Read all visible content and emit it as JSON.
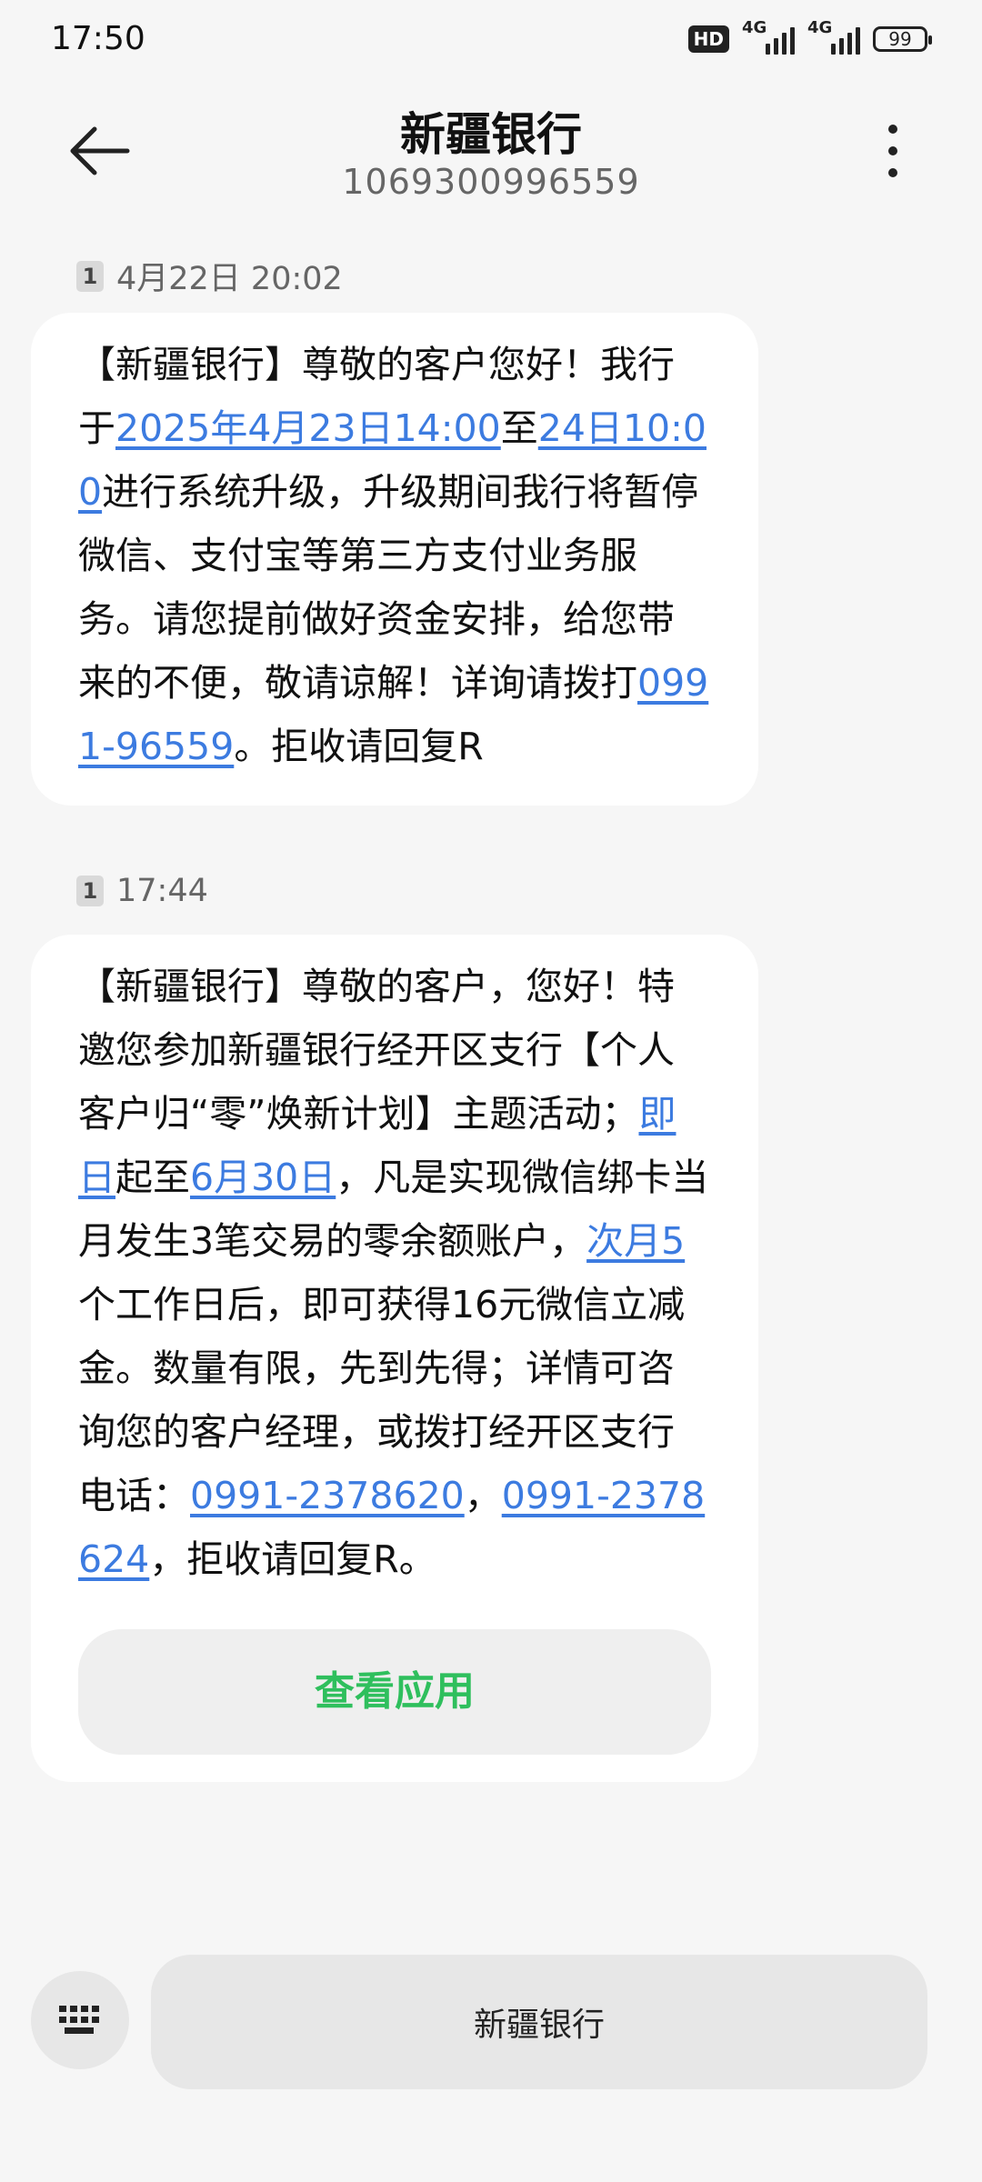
{
  "status_bar": {
    "time": "17:50",
    "hd_badge": "HD",
    "network_1": "4G",
    "network_2": "4G",
    "battery": "99"
  },
  "header": {
    "title": "新疆银行",
    "number": "1069300996559",
    "back_icon": "arrow-left-icon",
    "menu_icon": "more-vertical-icon"
  },
  "messages": [
    {
      "sim": "1",
      "timestamp": "4月22日 20:02",
      "segments": [
        {
          "text": "【新疆银行】尊敬的客户您好！我行于",
          "link": false
        },
        {
          "text": "2025年4月23日14:00",
          "link": true
        },
        {
          "text": "至",
          "link": false
        },
        {
          "text": "24日10:00",
          "link": true
        },
        {
          "text": "进行系统升级，升级期间我行将暂停微信、支付宝等第三方支付业务服务。请您提前做好资金安排，给您带来的不便，敬请谅解！详询请拨打",
          "link": false
        },
        {
          "text": "0991-96559",
          "link": true
        },
        {
          "text": "。拒收请回复R",
          "link": false
        }
      ]
    },
    {
      "sim": "1",
      "timestamp": "17:44",
      "segments": [
        {
          "text": "【新疆银行】尊敬的客户，您好！特邀您参加新疆银行经开区支行【个人客户归“零”焕新计划】主题活动；",
          "link": false
        },
        {
          "text": "即日",
          "link": true
        },
        {
          "text": "起至",
          "link": false
        },
        {
          "text": "6月30日",
          "link": true
        },
        {
          "text": "，凡是实现微信绑卡当月发生3笔交易的零余额账户，",
          "link": false
        },
        {
          "text": "次月5",
          "link": true
        },
        {
          "text": "个工作日后，即可获得16元微信立减金。数量有限，先到先得；详情可咨询您的客户经理，或拨打经开区支行电话：",
          "link": false
        },
        {
          "text": "0991-2378620",
          "link": true
        },
        {
          "text": "，",
          "link": false
        },
        {
          "text": "0991-2378624",
          "link": true
        },
        {
          "text": "，拒收请回复R。",
          "link": false
        }
      ],
      "action_button": "查看应用"
    }
  ],
  "bottom_bar": {
    "keyboard_icon": "keyboard-icon",
    "quick_reply": "新疆银行"
  },
  "colors": {
    "link": "#3c7be0",
    "action": "#2fbf5d",
    "background": "#f6f6f6"
  }
}
